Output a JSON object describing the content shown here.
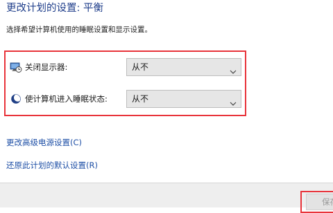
{
  "header": {
    "title": "更改计划的设置: 平衡",
    "subtitle": "选择希望计算机使用的睡眠设置和显示设置。"
  },
  "settings": {
    "display": {
      "label": "关闭显示器:",
      "value": "从不",
      "icon": "monitor-clock-icon"
    },
    "sleep": {
      "label": "使计算机进入睡眠状态:",
      "value": "从不",
      "icon": "sleep-moon-icon"
    }
  },
  "links": {
    "advanced": "更改高级电源设置(C)",
    "restore": "还原此计划的默认设置(R)"
  },
  "footer": {
    "save_label": "保存"
  },
  "colors": {
    "title": "#1e3d8a",
    "link": "#1e4fa6",
    "highlight": "#e8333a",
    "dropdown_bg": "#e6e6e6"
  }
}
